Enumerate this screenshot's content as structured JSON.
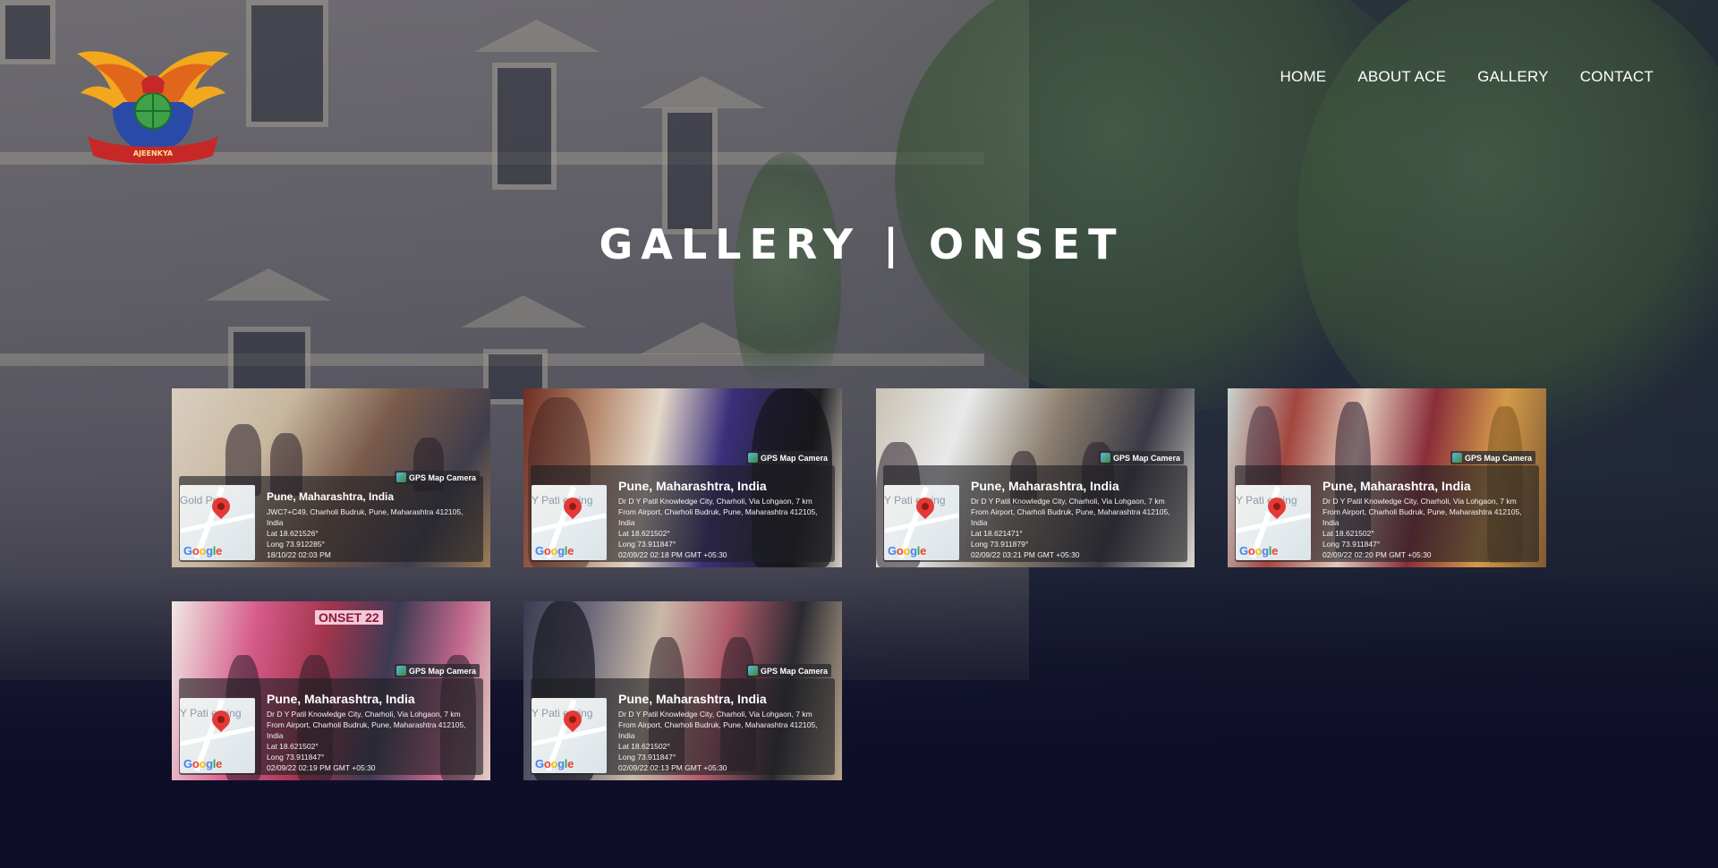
{
  "site": {
    "logo_text": "AJEENKYA"
  },
  "nav": {
    "items": [
      "HOME",
      "ABOUT ACE",
      "GALLERY",
      "CONTACT"
    ]
  },
  "page": {
    "title": "GALLERY | ONSET"
  },
  "gallery": [
    {
      "tag": "GPS Map Camera",
      "location": "Pune, Maharashtra, India",
      "map_text": "Gold Priy",
      "lines": [
        "JWC7+C49, Charholi Budruk, Pune, Maharashtra 412105, India",
        "Lat 18.621526°",
        "Long 73.912285°",
        "18/10/22 02:03 PM"
      ]
    },
    {
      "tag": "GPS Map Camera",
      "location": "Pune, Maharashtra, India",
      "map_text": "Y Pati eering",
      "lines": [
        "Dr D Y Patil Knowledge City, Charholi, Via Lohgaon, 7 km",
        "From Airport, Charholi Budruk, Pune, Maharashtra 412105,",
        "India",
        "Lat 18.621502°",
        "Long 73.911847°",
        "02/09/22 02:18 PM GMT +05:30"
      ]
    },
    {
      "tag": "GPS Map Camera",
      "location": "Pune, Maharashtra, India",
      "map_text": "Y Pati eering",
      "lines": [
        "Dr D Y Patil Knowledge City, Charholi, Via Lohgaon, 7 km",
        "From Airport, Charholi Budruk, Pune, Maharashtra 412105,",
        "India",
        "Lat 18.621471°",
        "Long 73.911879°",
        "02/09/22 03:21 PM GMT +05:30"
      ]
    },
    {
      "tag": "GPS Map Camera",
      "location": "Pune, Maharashtra, India",
      "map_text": "Y Pati eering",
      "lines": [
        "Dr D Y Patil Knowledge City, Charholi, Via Lohgaon, 7 km",
        "From Airport, Charholi Budruk, Pune, Maharashtra 412105,",
        "India",
        "Lat 18.621502°",
        "Long 73.911847°",
        "02/09/22 02:20 PM GMT +05:30"
      ]
    },
    {
      "tag": "GPS Map Camera",
      "location": "Pune, Maharashtra, India",
      "map_text": "Y Pati eering",
      "banner": "ONSET 22",
      "lines": [
        "Dr D Y Patil Knowledge City, Charholi, Via Lohgaon, 7 km",
        "From Airport, Charholi Budruk, Pune, Maharashtra 412105,",
        "India",
        "Lat 18.621502°",
        "Long 73.911847°",
        "02/09/22 02:19 PM GMT +05:30"
      ]
    },
    {
      "tag": "GPS Map Camera",
      "location": "Pune, Maharashtra, India",
      "map_text": "Y Pati eering",
      "lines": [
        "Dr D Y Patil Knowledge City, Charholi, Via Lohgaon, 7 km",
        "From Airport, Charholi Budruk, Pune, Maharashtra 412105,",
        "India",
        "Lat 18.621502°",
        "Long 73.911847°",
        "02/09/22 02:13 PM GMT +05:30"
      ]
    }
  ],
  "icons": {
    "logo": "winged-crest-logo",
    "map_pin": "map-pin-icon",
    "gps_camera": "gps-map-camera-icon"
  },
  "colors": {
    "overlay": "#1b1d3a",
    "pin": "#e53935",
    "logo_red": "#c62828",
    "logo_gold": "#f2a81d",
    "logo_blue": "#2a4aa8"
  }
}
